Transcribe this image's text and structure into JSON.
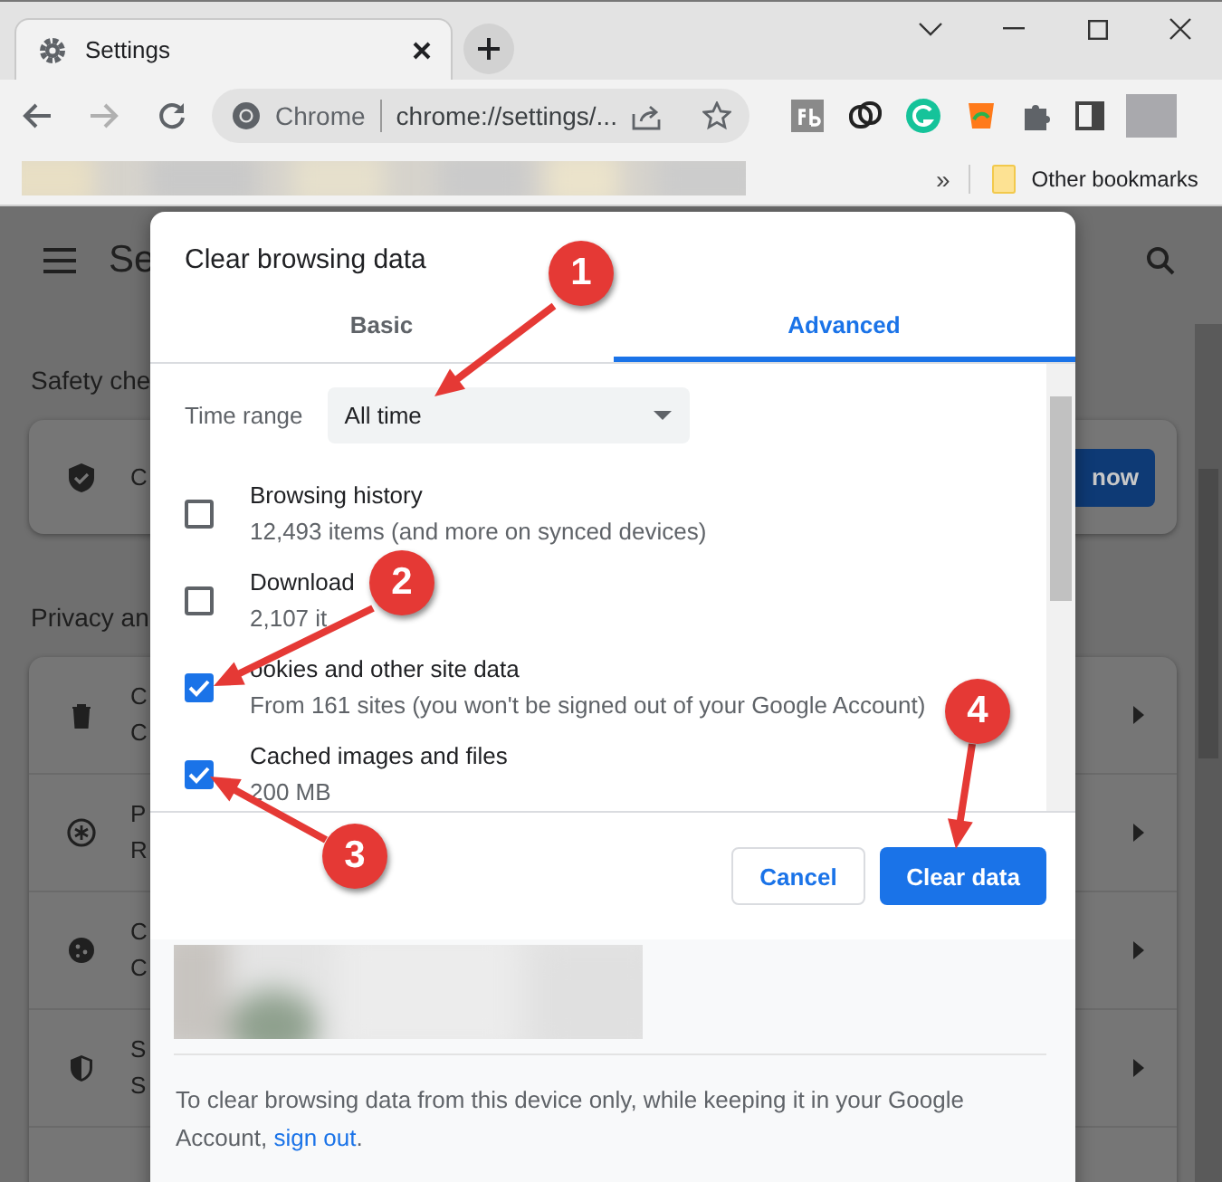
{
  "browser": {
    "tab": {
      "title": "Settings",
      "selected": true
    },
    "omnibox": {
      "site_label": "Chrome",
      "url": "chrome://settings/..."
    },
    "bookmarks": {
      "overflow": "»",
      "folder": "Other bookmarks"
    }
  },
  "background_page": {
    "title": "Se",
    "safety": {
      "heading": "Safety che",
      "card_text": "C",
      "button": "now"
    },
    "privacy": {
      "heading": "Privacy an",
      "rows": [
        {
          "title": "C",
          "subtitle": "C"
        },
        {
          "title": "P",
          "subtitle": "R"
        },
        {
          "title": "C",
          "subtitle": "C"
        },
        {
          "title": "S",
          "subtitle": "S"
        }
      ]
    }
  },
  "dialog": {
    "title": "Clear browsing data",
    "tabs": [
      {
        "label": "Basic",
        "selected": false
      },
      {
        "label": "Advanced",
        "selected": true
      }
    ],
    "time_range": {
      "label": "Time range",
      "value": "All time"
    },
    "items": [
      {
        "title": "Browsing history",
        "detail": "12,493 items (and more on synced devices)",
        "checked": false
      },
      {
        "title": "Download",
        "detail": "2,107 it",
        "checked": false
      },
      {
        "title": "ookies and other site data",
        "detail": "From 161 sites (you won't be signed out of your Google Account)",
        "checked": true
      },
      {
        "title": "Cached images and files",
        "detail": "200 MB",
        "checked": true
      }
    ],
    "buttons": [
      {
        "label": "Cancel",
        "kind": "secondary"
      },
      {
        "label": "Clear data",
        "kind": "primary"
      }
    ],
    "note": {
      "text": "To clear browsing data from this device only, while keeping it in your Google Account, ",
      "link": "sign out",
      "end": "."
    }
  },
  "annotations": [
    {
      "number": "1"
    },
    {
      "number": "2"
    },
    {
      "number": "3"
    },
    {
      "number": "4"
    }
  ]
}
